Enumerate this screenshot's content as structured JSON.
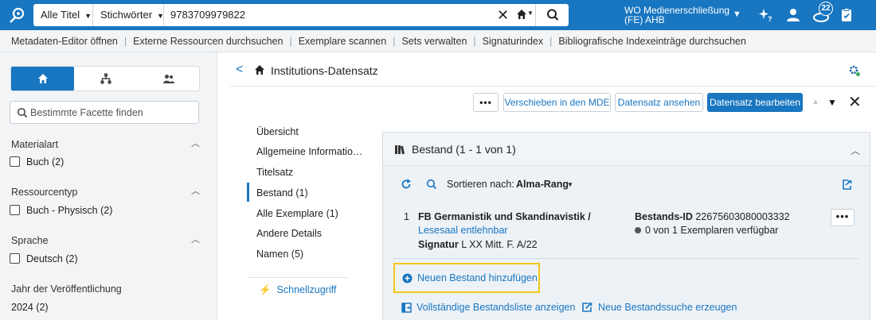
{
  "topbar": {
    "scope": "Alle Titel",
    "field": "Stichwörter",
    "query": "9783709979822",
    "institution": "WO Medienerschließung (FE) AHB",
    "badge": "22"
  },
  "subnav": [
    "Metadaten-Editor öffnen",
    "Externe Ressourcen durchsuchen",
    "Exemplare scannen",
    "Sets verwalten",
    "Signaturindex",
    "Bibliografische Indexeinträge durchsuchen"
  ],
  "facets": {
    "search_placeholder": "Bestimmte Facette finden",
    "groups": [
      {
        "title": "Materialart",
        "item": "Buch (2)"
      },
      {
        "title": "Ressourcentyp",
        "item": "Buch - Physisch (2)"
      },
      {
        "title": "Sprache",
        "item": "Deutsch (2)"
      },
      {
        "title": "Jahr der Veröffentlichung",
        "item": "2024 (2)"
      }
    ]
  },
  "main": {
    "title": "Institutions-Datensatz",
    "buttons": {
      "more": "•••",
      "move": "Verschieben in den MDE",
      "view": "Datensatz ansehen",
      "edit": "Datensatz bearbeiten"
    }
  },
  "nav": [
    {
      "label": "Übersicht",
      "count": ""
    },
    {
      "label": "Allgemeine Informatio…",
      "count": ""
    },
    {
      "label": "Titelsatz",
      "count": ""
    },
    {
      "label": "Bestand",
      "count": "(1)"
    },
    {
      "label": "Alle Exemplare",
      "count": "(1)"
    },
    {
      "label": "Andere Details",
      "count": ""
    },
    {
      "label": "Namen",
      "count": "(5)"
    }
  ],
  "quick_access": "Schnellzugriff",
  "holdings": {
    "title": "Bestand (1 - 1 von 1)",
    "sort_label": "Sortieren nach:",
    "sort_value": "Alma-Rang",
    "row": {
      "num": "1",
      "library": "FB Germanistik und Skandinavistik /",
      "location": "Lesesaal entlehnbar",
      "call_label": "Signatur",
      "call_value": "L XX Mitt. F. A/22",
      "hid_label": "Bestands-ID",
      "hid_value": "22675603080003332",
      "availability": "0 von 1 Exemplaren verfügbar"
    },
    "add": "Neuen Bestand hinzufügen",
    "full_list": "Vollständige Bestandsliste anzeigen",
    "new_search": "Neue Bestandssuche erzeugen"
  },
  "colors": {
    "brand": "#1976c0",
    "highlight": "#f5c518"
  }
}
